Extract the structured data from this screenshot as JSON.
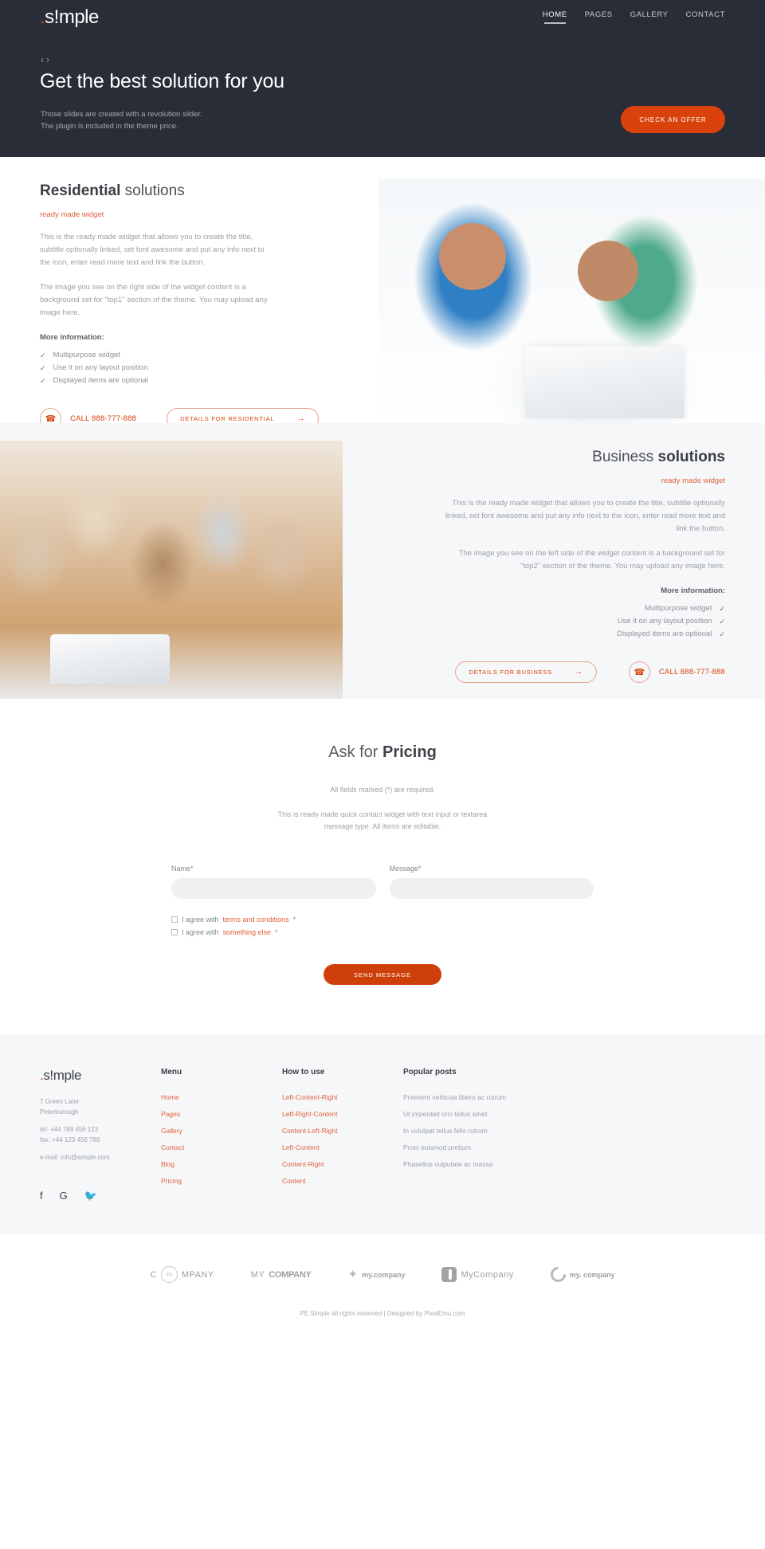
{
  "header": {
    "logo_dot": ".",
    "logo_text": "s!mple",
    "nav": [
      {
        "label": "HOME",
        "active": true
      },
      {
        "label": "PAGES",
        "active": false
      },
      {
        "label": "GALLERY",
        "active": false
      },
      {
        "label": "CONTACT",
        "active": false
      }
    ]
  },
  "hero": {
    "prev_arrow": "‹",
    "next_arrow": "›",
    "title": "Get the best solution for you",
    "subtitle_line1": "Those slides are created with a revolution slider.",
    "subtitle_line2": "The plugin is included in the theme price.",
    "cta_label": "CHECK AN OFFER",
    "bg_color": "#282d37",
    "accent_color": "#d9420b"
  },
  "residential": {
    "title_bold": "Residential",
    "title_light": " solutions",
    "subtitle": "ready made widget",
    "paragraph1": "This is the ready made widget that allows you to create the title, subtitle optionally linked, set font awesome and put any info next to the icon, enter read more text and link the button.",
    "paragraph2": "The image you see on the right side of the widget content is a background set for \"top1\" section of the theme. You may upload any image here.",
    "more_info_label": "More information:",
    "list": [
      "Multipurpose widget",
      "Use it on any layout position",
      "Displayed items are optional"
    ],
    "phone_icon": "phone-icon",
    "phone_label": "CALL 888-777-888",
    "details_label": "DETAILS FOR RESIDENTIAL",
    "details_arrow": "→"
  },
  "business": {
    "title_light": "Business",
    "title_bold": " solutions",
    "subtitle": "ready made widget",
    "paragraph1": "This is the ready made widget that allows you to create the title, subtitle optionally linked, set font awesome and put any info next to the icon, enter read more text and link the button.",
    "paragraph2": "The image you see on the left side of the widget content is a background set for \"top2\" section of the theme. You may upload any image here.",
    "more_info_label": "More information:",
    "list": [
      "Multipurpose widget",
      "Use it on any layout position",
      "Displayed items are optional"
    ],
    "details_label": "DETAILS FOR BUSINESS",
    "details_arrow": "→",
    "phone_label": "CALL 888-777-888"
  },
  "pricing": {
    "title_light": "Ask for ",
    "title_bold": "Pricing",
    "required_note": "All fields marked (*) are required.",
    "widget_note_line1": "This is ready made quick contact widget with text input or textarea",
    "widget_note_line2": "message type. All items are editable.",
    "name_label": "Name*",
    "name_value": "",
    "name_placeholder": "",
    "message_label": "Message*",
    "message_value": "",
    "message_placeholder": "",
    "agree1_prefix": "I agree with ",
    "agree1_link": "terms and conditions",
    "agree1_suffix": " *",
    "agree2_prefix": "I agree with ",
    "agree2_link": "something else",
    "agree2_suffix": " *",
    "send_label": "SEND MESSAGE"
  },
  "footer": {
    "logo_dot": ".",
    "logo_text": "s!mple",
    "address_line1": "7 Green Lane",
    "address_line2": "Peterborough",
    "tel": "tel: +44 789 456 123",
    "fax": "fax: +44 123 456 789",
    "email": "e-mail: info@simple.com",
    "socials": [
      {
        "name": "facebook-icon",
        "glyph": "f"
      },
      {
        "name": "google-plus-icon",
        "glyph": "G"
      },
      {
        "name": "twitter-icon",
        "glyph": "🐦"
      }
    ],
    "menu_head": "Menu",
    "menu_links": [
      "Home",
      "Pages",
      "Gallery",
      "Contact",
      "Blog",
      "Pricing"
    ],
    "howto_head": "How to use",
    "howto_links": [
      "Left-Content-Right",
      "Left-Right-Content",
      "Content-Left-Right",
      "Left-Content",
      "Content-Right",
      "Content"
    ],
    "posts_head": "Popular posts",
    "posts": [
      "Praesent vehicula libero ac rutrum",
      "Ut imperdiet orci tellus amet",
      "In volutpat tellus felis rutrum",
      "Proin euismod pretium",
      "Phasellus vulputate ac massa"
    ]
  },
  "clients": [
    {
      "name": "company-logo-1",
      "pre": "C",
      "ring": "my",
      "post": "MPANY"
    },
    {
      "name": "company-logo-2",
      "pre": "MY",
      "post": "COMPANY"
    },
    {
      "name": "company-logo-3",
      "post": "my.company"
    },
    {
      "name": "company-logo-4",
      "post": "MyCompany"
    },
    {
      "name": "company-logo-5",
      "post": "my. company"
    }
  ],
  "copyright": "PE Simple all rights reserved | Designed by PixelEmu.com"
}
